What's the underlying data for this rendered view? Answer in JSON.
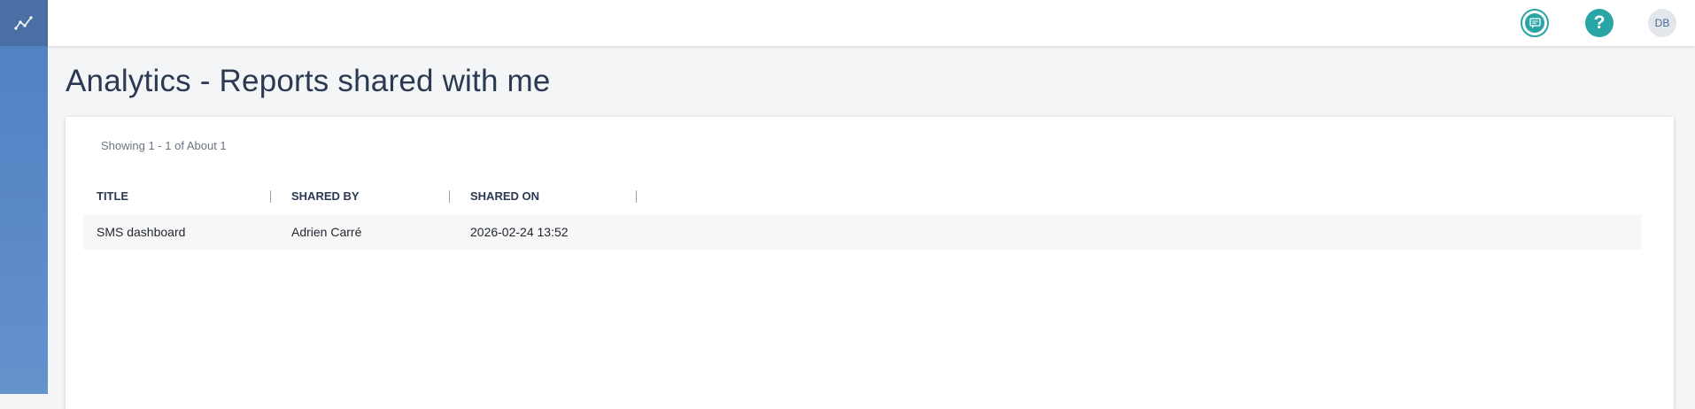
{
  "sidebar": {
    "logo_icon": "line-chart-icon"
  },
  "header": {
    "feedback_icon": "feedback-chat-icon",
    "help_label": "?",
    "avatar_initials": "DB"
  },
  "page": {
    "title": "Analytics - Reports shared with me"
  },
  "list": {
    "showing": "Showing 1 - 1 of About 1",
    "columns": [
      "TITLE",
      "SHARED BY",
      "SHARED ON"
    ],
    "rows": [
      {
        "title": "SMS dashboard",
        "shared_by": "Adrien Carré",
        "shared_on": "2026-02-24 13:52"
      }
    ]
  },
  "colors": {
    "accent": "#2aa5a6",
    "sidebar": "#4f7fc1",
    "title_text": "#2b3a52"
  }
}
